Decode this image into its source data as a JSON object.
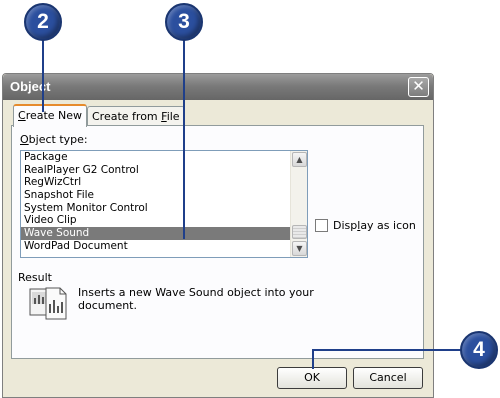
{
  "callouts": [
    "2",
    "3",
    "4"
  ],
  "dialog": {
    "title": "Object",
    "close_glyph": "✕",
    "tabs": [
      {
        "pre": "",
        "u": "C",
        "post": "reate New"
      },
      {
        "pre": "Create from ",
        "u": "F",
        "post": "ile"
      }
    ],
    "object_type_label": {
      "pre": "",
      "u": "O",
      "post": "bject type:"
    },
    "object_types": [
      "Package",
      "RealPlayer G2 Control",
      "RegWizCtrl",
      "Snapshot File",
      "System Monitor Control",
      "Video Clip",
      "Wave Sound",
      "WordPad Document"
    ],
    "selected_object_type": "Wave Sound",
    "display_as_icon": {
      "pre": "Disp",
      "u": "l",
      "post": "ay as icon",
      "checked": false
    },
    "result_label": "Result",
    "result_line1": "Inserts a new Wave Sound object into your",
    "result_line2": "document.",
    "ok_label": "OK",
    "cancel_label": "Cancel"
  },
  "colors": {
    "callout": "#2b4f9e",
    "titlebar": "#7a7a7a",
    "selection": "#7a7a7a",
    "dialog_bg": "#ece9d8"
  },
  "icons": {
    "scroll_up": "▲",
    "scroll_down": "▼"
  }
}
